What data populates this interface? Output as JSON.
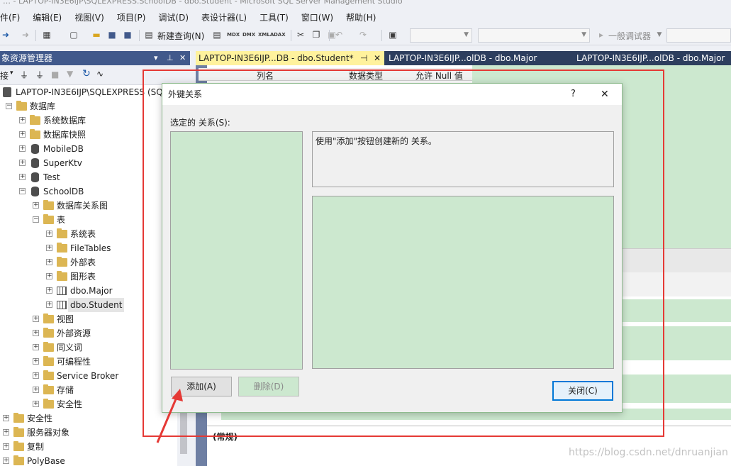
{
  "window": {
    "title": "… - LAPTOP-IN3E6IJP\\SQLEXPRESS.SchoolDB - dbo.Student - Microsoft SQL Server Management Studio"
  },
  "menu": [
    "件(F)",
    "编辑(E)",
    "视图(V)",
    "项目(P)",
    "调试(D)",
    "表设计器(L)",
    "工具(T)",
    "窗口(W)",
    "帮助(H)"
  ],
  "toolbar": {
    "new_query": "新建查询(N)",
    "debugger": "一般调试器",
    "icons": [
      "MDX",
      "DMX",
      "XMLA",
      "DAX"
    ]
  },
  "object_explorer": {
    "title": "象资源管理器",
    "connect": "接",
    "server": "LAPTOP-IN3E6IJP\\SQLEXPRESS (SQ",
    "tree": [
      {
        "label": "数据库",
        "icon": "folder"
      },
      {
        "label": "系统数据库",
        "icon": "folder"
      },
      {
        "label": "数据库快照",
        "icon": "folder"
      },
      {
        "label": "MobileDB",
        "icon": "database"
      },
      {
        "label": "SuperKtv",
        "icon": "database"
      },
      {
        "label": "Test",
        "icon": "database"
      },
      {
        "label": "SchoolDB",
        "icon": "database"
      },
      {
        "label": "数据库关系图",
        "icon": "folder"
      },
      {
        "label": "表",
        "icon": "folder"
      },
      {
        "label": "系统表",
        "icon": "folder"
      },
      {
        "label": "FileTables",
        "icon": "folder"
      },
      {
        "label": "外部表",
        "icon": "folder"
      },
      {
        "label": "图形表",
        "icon": "folder"
      },
      {
        "label": "dbo.Major",
        "icon": "table"
      },
      {
        "label": "dbo.Student",
        "icon": "table"
      },
      {
        "label": "视图",
        "icon": "folder"
      },
      {
        "label": "外部资源",
        "icon": "folder"
      },
      {
        "label": "同义词",
        "icon": "folder"
      },
      {
        "label": "可编程性",
        "icon": "folder"
      },
      {
        "label": "Service Broker",
        "icon": "folder"
      },
      {
        "label": "存储",
        "icon": "folder"
      },
      {
        "label": "安全性",
        "icon": "folder"
      },
      {
        "label": "安全性",
        "icon": "folder"
      },
      {
        "label": "服务器对象",
        "icon": "folder"
      },
      {
        "label": "复制",
        "icon": "folder"
      },
      {
        "label": "PolyBase",
        "icon": "folder"
      }
    ]
  },
  "tabs": [
    {
      "label": "LAPTOP-IN3E6IJP...DB - dbo.Student*",
      "active": true
    },
    {
      "label": "LAPTOP-IN3E6IJP...olDB - dbo.Major",
      "active": false
    },
    {
      "label": "LAPTOP-IN3E6IJP...olDB - dbo.Major",
      "active": false
    }
  ],
  "designer": {
    "col_name": "列名",
    "col_type": "数据类型",
    "col_null": "允许 Null 值",
    "props_section": "(常规)"
  },
  "dialog": {
    "title": "外键关系",
    "help": "?",
    "close_x": "✕",
    "selected_label": "选定的 关系(S):",
    "hint": "使用\"添加\"按钮创建新的 关系。",
    "add_button": "添加(A)",
    "delete_button": "删除(D)",
    "close_button": "关闭(C)"
  },
  "watermark": "https://blog.csdn.net/dnruanjian",
  "colors": {
    "accent": "#0078d7",
    "highlight": "#e53935",
    "panel_green": "#cce8cf",
    "tab_active": "#fff29d",
    "tab_bar": "#2d3e5e",
    "oe_header": "#41598b"
  }
}
